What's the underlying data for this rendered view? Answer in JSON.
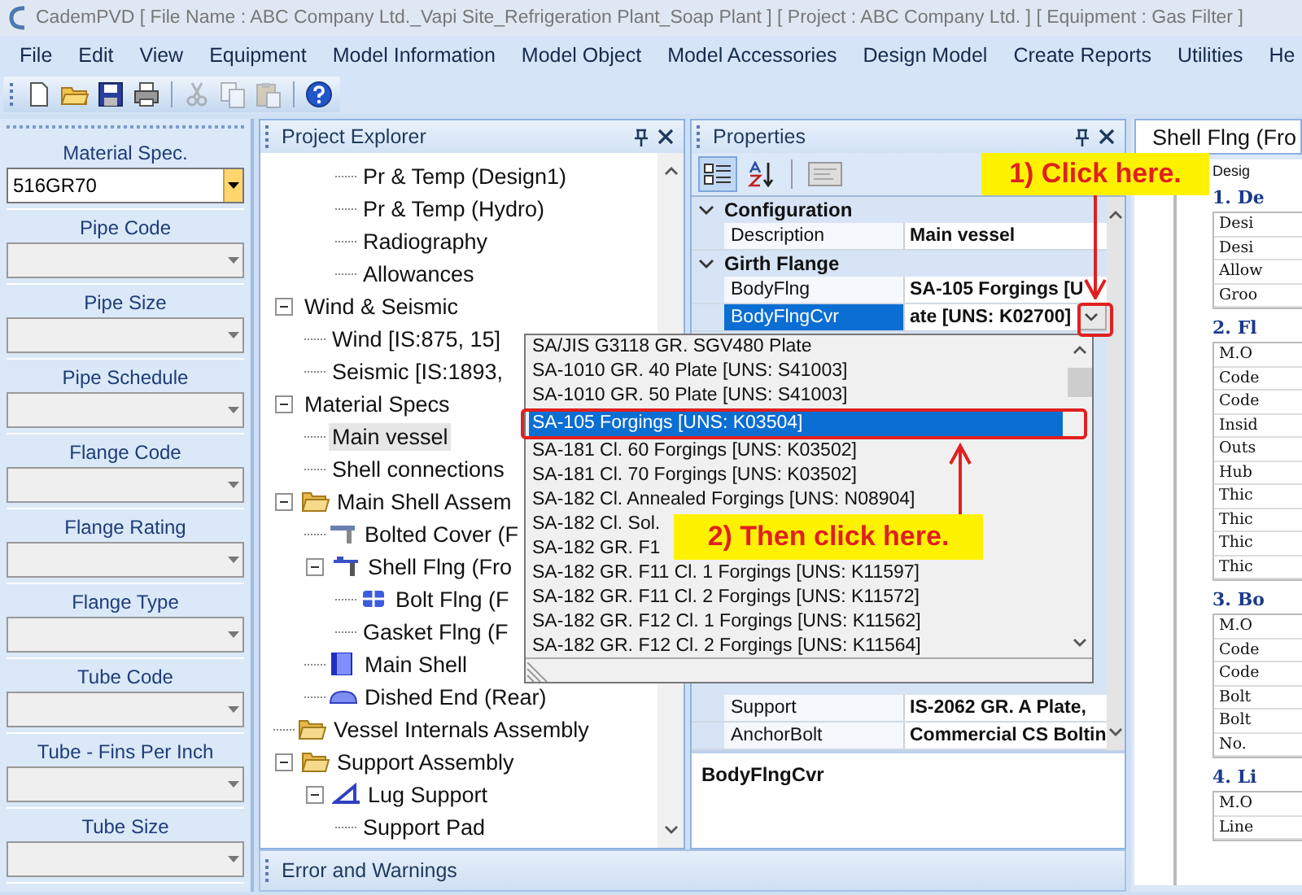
{
  "window": {
    "title": "CademPVD [ File Name : ABC Company Ltd._Vapi Site_Refrigeration Plant_Soap Plant ] [ Project : ABC Company Ltd. ] [ Equipment : Gas Filter ]"
  },
  "menu": [
    "File",
    "Edit",
    "View",
    "Equipment",
    "Model Information",
    "Model Object",
    "Model Accessories",
    "Design Model",
    "Create Reports",
    "Utilities",
    "He"
  ],
  "toolbar": [
    {
      "kind": "new",
      "disabled": false
    },
    {
      "kind": "open",
      "disabled": false
    },
    {
      "kind": "save",
      "disabled": false
    },
    {
      "kind": "print",
      "disabled": false
    },
    {
      "kind": "separator"
    },
    {
      "kind": "cut",
      "disabled": true
    },
    {
      "kind": "copy",
      "disabled": true
    },
    {
      "kind": "paste",
      "disabled": true
    },
    {
      "kind": "separator"
    },
    {
      "kind": "help",
      "disabled": false
    }
  ],
  "spec_panel": [
    {
      "label": "Material Spec.",
      "value": "516GR70",
      "focused": true
    },
    {
      "label": "Pipe Code",
      "focused": false
    },
    {
      "label": "Pipe Size",
      "focused": false
    },
    {
      "label": "Pipe Schedule",
      "focused": false
    },
    {
      "label": "Flange Code",
      "focused": false
    },
    {
      "label": "Flange Rating",
      "focused": false
    },
    {
      "label": "Flange Type",
      "focused": false
    },
    {
      "label": "Tube Code",
      "focused": false
    },
    {
      "label": "Tube - Fins Per Inch",
      "focused": false
    },
    {
      "label": "Tube Size",
      "focused": false
    }
  ],
  "explorer": {
    "title": "Project Explorer",
    "tree": [
      {
        "children": [
          {
            "children": [
              {
                "label": "Pr & Temp (Design1)",
                "kind": "plain",
                "selected": false
              },
              {
                "label": "Pr & Temp (Hydro)",
                "kind": "plain",
                "selected": false
              },
              {
                "label": "Radiography",
                "kind": "plain",
                "selected": false
              },
              {
                "label": "Allowances",
                "kind": "plain",
                "selected": false
              }
            ]
          }
        ]
      },
      {
        "label": "Wind & Seismic",
        "kind": "plain",
        "selected": false,
        "expanded": true,
        "children": [
          {
            "label": "Wind [IS:875, 15]",
            "kind": "plain",
            "selected": false
          },
          {
            "label": "Seismic [IS:1893,",
            "kind": "plain",
            "selected": false
          }
        ]
      },
      {
        "label": "Material Specs",
        "kind": "plain",
        "selected": false,
        "expanded": true,
        "children": [
          {
            "label": "Main vessel",
            "kind": "plain",
            "selected": true
          },
          {
            "label": "Shell connections",
            "kind": "plain",
            "selected": false
          }
        ]
      },
      {
        "label": "Main Shell Assem",
        "kind": "folder",
        "selected": false,
        "expanded": true,
        "children": [
          {
            "label": "Bolted Cover (F",
            "kind": "cover",
            "selected": false
          },
          {
            "label": "Shell Flng (Fro",
            "kind": "flange",
            "selected": false,
            "expanded": true,
            "children": [
              {
                "label": "Bolt Flng (F",
                "kind": "bolt",
                "selected": false
              },
              {
                "label": "Gasket Flng (F",
                "kind": "plain",
                "selected": false
              }
            ]
          },
          {
            "label": "Main Shell",
            "kind": "shell",
            "selected": false
          },
          {
            "label": "Dished End (Rear)",
            "kind": "head",
            "selected": false
          }
        ]
      },
      {
        "label": "Vessel Internals Assembly",
        "kind": "folder",
        "selected": false
      },
      {
        "label": "Support Assembly",
        "kind": "folder",
        "selected": false,
        "expanded": true,
        "children": [
          {
            "label": "Lug Support",
            "kind": "lug",
            "selected": false,
            "expanded": true,
            "children": [
              {
                "label": "Support Pad",
                "kind": "plain",
                "selected": false
              }
            ]
          }
        ]
      }
    ]
  },
  "properties": {
    "title": "Properties",
    "toolbar": [
      {
        "kind": "categorized",
        "selected": true
      },
      {
        "kind": "alphabetical",
        "selected": false
      },
      {
        "kind": "separator"
      },
      {
        "kind": "pages",
        "selected": false
      }
    ],
    "categories": [
      {
        "name": "Configuration",
        "expanded": true,
        "rows": [
          {
            "name": "Description",
            "value": "Main vessel",
            "selected": false
          }
        ]
      },
      {
        "name": "Girth Flange",
        "expanded": true,
        "rows": [
          {
            "name": "BodyFlng",
            "value": "SA-105 Forgings [U",
            "selected": false
          },
          {
            "name": "BodyFlngCvr",
            "value": "ate [UNS: K02700]",
            "selected": true
          }
        ]
      }
    ],
    "more_rows": [
      {
        "name": "Support",
        "value": "IS-2062 GR. A Plate,",
        "selected": false
      },
      {
        "name": "AnchorBolt",
        "value": "Commercial CS Boltin",
        "selected": false
      }
    ],
    "description": "BodyFlngCvr"
  },
  "dropdown": {
    "items": [
      {
        "label": "SA/JIS G3118 GR. SGV480 Plate",
        "selected": false
      },
      {
        "label": "SA-1010 GR. 40 Plate [UNS: S41003]",
        "selected": false
      },
      {
        "label": "SA-1010 GR. 50 Plate [UNS: S41003]",
        "selected": false
      },
      {
        "label": "SA-105 Forgings [UNS: K03504]",
        "selected": true
      },
      {
        "label": "SA-181 Cl. 60 Forgings [UNS: K03502]",
        "selected": false
      },
      {
        "label": "SA-181 Cl. 70 Forgings [UNS: K03502]",
        "selected": false
      },
      {
        "label": "SA-182 Cl. Annealed Forgings [UNS: N08904]",
        "selected": false
      },
      {
        "label": "SA-182 Cl. Sol.",
        "selected": false
      },
      {
        "label": "SA-182 GR. F1",
        "selected": false
      },
      {
        "label": "SA-182 GR. F11 Cl. 1 Forgings [UNS: K11597]",
        "selected": false
      },
      {
        "label": "SA-182 GR. F11 Cl. 2 Forgings [UNS: K11572]",
        "selected": false
      },
      {
        "label": "SA-182 GR. F12 Cl. 1 Forgings [UNS: K11562]",
        "selected": false
      },
      {
        "label": "SA-182 GR. F12 Cl. 2 Forgings [UNS: K11564]",
        "selected": false
      }
    ]
  },
  "callouts": [
    {
      "text": "1) Click here."
    },
    {
      "text": "2) Then click here."
    }
  ],
  "document": {
    "tab": "Shell Flng (Fro",
    "caption": "Desig",
    "sections": [
      {
        "heading": "1. De",
        "rows": [
          "Desi",
          "Desi",
          "Allow",
          "Groo"
        ]
      },
      {
        "heading": "2. Fl",
        "rows": [
          "M.O",
          "Code",
          "Code",
          "Insid",
          "Outs",
          "Hub",
          "Thic",
          "Thic",
          "Thic",
          "Thic"
        ]
      },
      {
        "heading": "3. Bo",
        "rows": [
          "M.O",
          "Code",
          "Code",
          "Bolt",
          "Bolt",
          "No."
        ]
      },
      {
        "heading": "4. Li",
        "rows": [
          "M.O",
          "Line"
        ]
      }
    ]
  },
  "status_bar": {
    "title": "Error and Warnings"
  }
}
